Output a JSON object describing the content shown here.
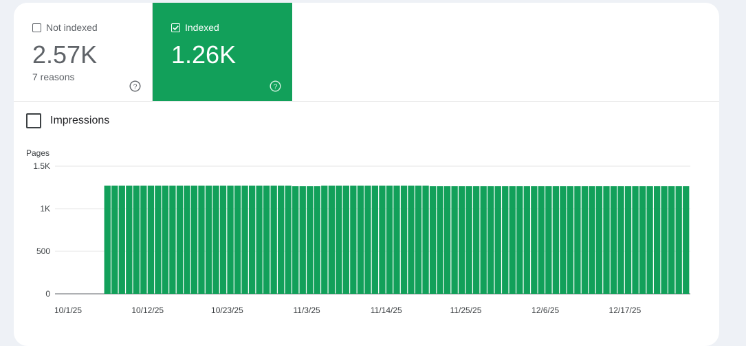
{
  "tiles": {
    "not_indexed": {
      "label": "Not indexed",
      "value": "2.57K",
      "sub": "7 reasons",
      "checked": false
    },
    "indexed": {
      "label": "Indexed",
      "value": "1.26K",
      "checked": true
    }
  },
  "impressions": {
    "label": "Impressions",
    "checked": false
  },
  "colors": {
    "indexed_green": "#12a05a"
  },
  "chart_data": {
    "type": "bar",
    "ylabel": "Pages",
    "ylim": [
      0,
      1500
    ],
    "yticks": [
      {
        "value": 0,
        "label": "0"
      },
      {
        "value": 500,
        "label": "500"
      },
      {
        "value": 1000,
        "label": "1K"
      },
      {
        "value": 1500,
        "label": "1.5K"
      }
    ],
    "x_labels": [
      "10/1/25",
      "10/12/25",
      "10/23/25",
      "11/3/25",
      "11/14/25",
      "11/25/25",
      "12/6/25",
      "12/17/25"
    ],
    "x_start": "10/1/25",
    "x_end": "12/23/25",
    "series": [
      {
        "name": "Indexed",
        "first_date": "10/6/25",
        "values": [
          1270,
          1270,
          1270,
          1270,
          1270,
          1270,
          1270,
          1270,
          1270,
          1270,
          1270,
          1270,
          1270,
          1270,
          1270,
          1270,
          1270,
          1270,
          1270,
          1270,
          1270,
          1270,
          1270,
          1270,
          1270,
          1270,
          1265,
          1265,
          1265,
          1265,
          1270,
          1270,
          1270,
          1270,
          1270,
          1270,
          1270,
          1270,
          1270,
          1270,
          1270,
          1270,
          1270,
          1270,
          1270,
          1265,
          1265,
          1265,
          1265,
          1265,
          1265,
          1265,
          1265,
          1265,
          1265,
          1265,
          1265,
          1265,
          1265,
          1265,
          1265,
          1265,
          1265,
          1265,
          1265,
          1265,
          1265,
          1265,
          1265,
          1265,
          1265,
          1265,
          1265,
          1265,
          1265,
          1265,
          1265,
          1265,
          1265,
          1265,
          1265
        ]
      }
    ]
  }
}
